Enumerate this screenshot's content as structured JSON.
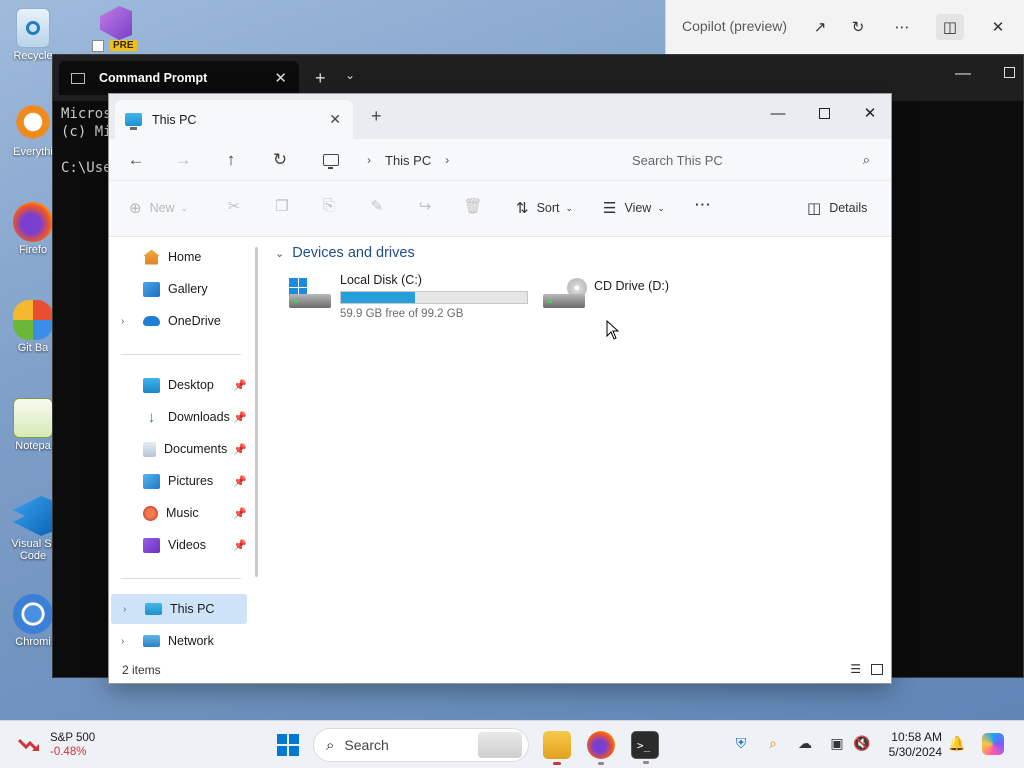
{
  "desktop": {
    "icons": [
      {
        "label": "Recycle",
        "icon": "recycle-bin-icon"
      },
      {
        "label": "Everythi",
        "icon": "everything-search-icon"
      },
      {
        "label": "Firefo",
        "icon": "firefox-icon"
      },
      {
        "label": "Git Ba",
        "icon": "git-bash-icon"
      },
      {
        "label": "Notepa",
        "icon": "notepad-plus-plus-icon"
      },
      {
        "label": "Visual St",
        "label2": "Code",
        "icon": "vscode-icon"
      },
      {
        "label": "Chromi",
        "icon": "chromium-icon"
      }
    ],
    "vs_badge": "PRE"
  },
  "copilot": {
    "title": "Copilot (preview)",
    "buttons": [
      "open-external-icon",
      "refresh-icon",
      "more-icon",
      "sidebar-icon",
      "close-icon"
    ]
  },
  "cmd": {
    "tab_title": "Command Prompt",
    "lines": [
      "Micros",
      "(c) Mi",
      "",
      "C:\\Use"
    ]
  },
  "explorer": {
    "tab_title": "This PC",
    "address": {
      "segment": "This PC"
    },
    "search_placeholder": "Search This PC",
    "commands": {
      "new": "New",
      "sort": "Sort",
      "view": "View",
      "details": "Details"
    },
    "nav": {
      "home": "Home",
      "gallery": "Gallery",
      "onedrive": "OneDrive",
      "desktop": "Desktop",
      "downloads": "Downloads",
      "documents": "Documents",
      "pictures": "Pictures",
      "music": "Music",
      "videos": "Videos",
      "this_pc": "This PC",
      "network": "Network"
    },
    "group_title": "Devices and drives",
    "drives": [
      {
        "name": "Local Disk (C:)",
        "free_text": "59.9 GB free of 99.2 GB",
        "used_fraction": 0.396
      },
      {
        "name": "CD Drive (D:)"
      }
    ],
    "status": {
      "count": "2 items"
    }
  },
  "taskbar": {
    "stock_name": "S&P 500",
    "stock_change": "-0.48%",
    "search_label": "Search",
    "apps": [
      "file-explorer",
      "firefox",
      "terminal"
    ],
    "clock_time": "10:58 AM",
    "clock_date": "5/30/2024"
  },
  "colors": {
    "accent": "#0078d4",
    "drive_bar": "#26a0da",
    "negative": "#d13438",
    "group_title": "#1f4e8c"
  }
}
